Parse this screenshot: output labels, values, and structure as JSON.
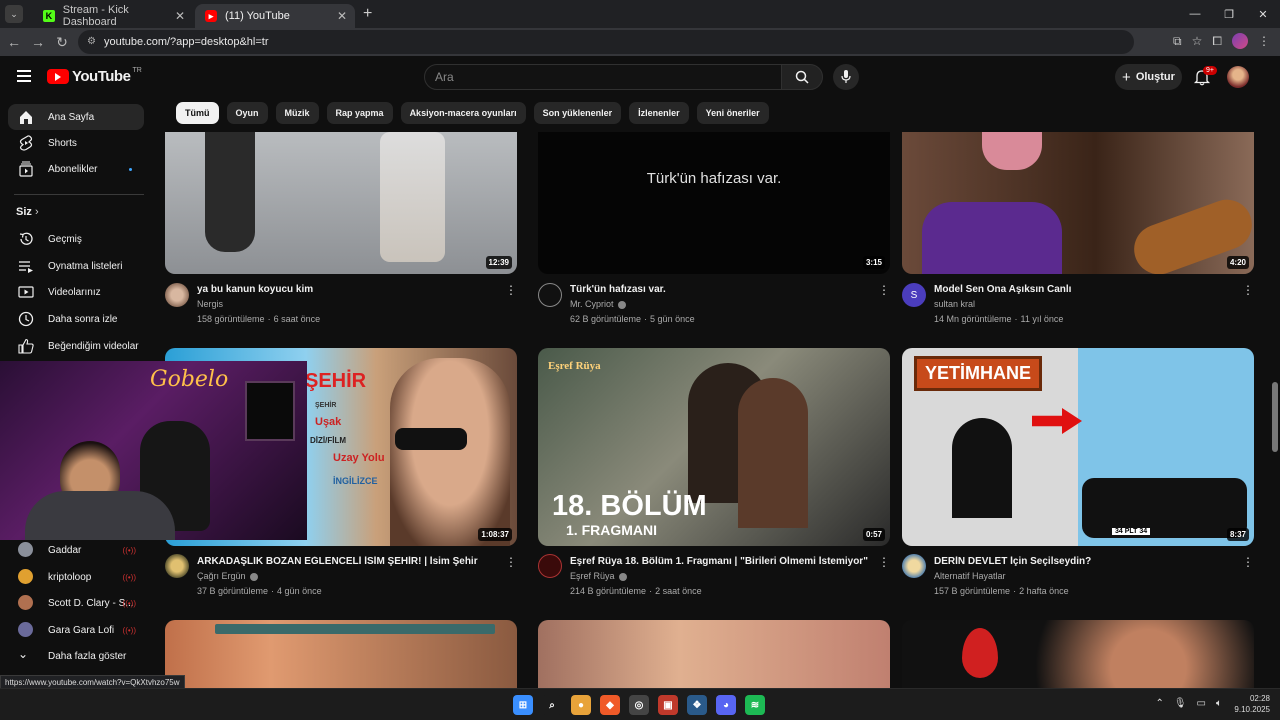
{
  "browser": {
    "tabs": [
      {
        "title": "Stream - Kick Dashboard",
        "favicon": "kick-icon",
        "active": false
      },
      {
        "title": "(11) YouTube",
        "favicon": "youtube-icon",
        "active": true
      }
    ],
    "url": "youtube.com/?app=desktop&hl=tr",
    "status_url": "https://www.youtube.com/watch?v=QkXtvhzo75w"
  },
  "header": {
    "logo_text": "YouTube",
    "logo_region": "TR",
    "search_placeholder": "Ara",
    "create_label": "Oluştur",
    "notifications_badge": "9+"
  },
  "sidebar": {
    "main": [
      {
        "label": "Ana Sayfa",
        "icon": "home-icon",
        "active": true
      },
      {
        "label": "Shorts",
        "icon": "shorts-icon"
      },
      {
        "label": "Abonelikler",
        "icon": "subscriptions-icon",
        "dot": true
      }
    ],
    "you_label": "Siz",
    "you_items": [
      {
        "label": "Geçmiş",
        "icon": "history-icon"
      },
      {
        "label": "Oynatma listeleri",
        "icon": "playlists-icon"
      },
      {
        "label": "Videolarınız",
        "icon": "your-videos-icon"
      },
      {
        "label": "Daha sonra izle",
        "icon": "watch-later-icon"
      },
      {
        "label": "Beğendiğim videolar",
        "icon": "liked-videos-icon"
      }
    ],
    "subscriptions": [
      {
        "label": "Gaddar",
        "color": "#8a8f9a"
      },
      {
        "label": "kriptoloop",
        "color": "#e0a030"
      },
      {
        "label": "Scott D. Clary - S...",
        "color": "#b07050"
      },
      {
        "label": "Gara Gara Lofi",
        "color": "#6a6a9a"
      }
    ],
    "show_more": "Daha fazla göster"
  },
  "chips": [
    "Tümü",
    "Oyun",
    "Müzik",
    "Rap yapma",
    "Aksiyon-macera oyunları",
    "Son yüklenenler",
    "İzlenenler",
    "Yeni öneriler"
  ],
  "videos_row1": [
    {
      "title": "ya bu kanun koyucu kim",
      "channel": "Nergis",
      "views": "158 görüntüleme",
      "age": "6 saat önce",
      "duration": "12:39",
      "verified": false
    },
    {
      "title": "Türk'ün hafızası var.",
      "channel": "Mr. Cypriot",
      "views": "62 B görüntüleme",
      "age": "5 gün önce",
      "duration": "3:15",
      "verified": true,
      "thumb_text": "Türk'ün hafızası var."
    },
    {
      "title": "Model  Sen Ona Aşıksın Canlı",
      "channel": "sultan kral",
      "views": "14 Mn görüntüleme",
      "age": "11 yıl önce",
      "duration": "4:20",
      "verified": false,
      "avatar_letter": "S"
    }
  ],
  "videos_row2": [
    {
      "title": "ARKADAŞLIK BOZAN EĞLENCELİ İSİM ŞEHİR! | İsim Şehir",
      "channel": "Çağrı Ergün",
      "views": "37 B görüntüleme",
      "age": "4 gün önce",
      "duration": "1:08:37",
      "verified": true,
      "thumb_words": [
        "ŞEHİR",
        "Uşak",
        "DİZİ/FİLM",
        "Uzay Yolu",
        "İNGİLİZCE"
      ]
    },
    {
      "title": "Eşref Rüya 18. Bölüm 1. Fragmanı | \"Birileri Ölmemi İstemiyor\"",
      "channel": "Eşref Rüya",
      "views": "214 B görüntüleme",
      "age": "2 saat önce",
      "duration": "0:57",
      "verified": true,
      "thumb_logo": "Eşref Rüya",
      "thumb_big": "18. BÖLÜM",
      "thumb_sub": "1. FRAGMANI"
    },
    {
      "title": "DERİN DEVLET İçin Seçilseydin?",
      "channel": "Alternatif Hayatlar",
      "views": "157 B görüntüleme",
      "age": "2 hafta önce",
      "duration": "8:37",
      "verified": false,
      "thumb_sign": "YETİMHANE",
      "thumb_plate": "34 PLT 34"
    }
  ],
  "webcam": {
    "neon_text": "Gobelo"
  },
  "taskbar": {
    "time": "02:28",
    "date": "9.10.2025",
    "apps": [
      {
        "name": "windows-start-icon",
        "color": "#3a8fff",
        "glyph": "⊞"
      },
      {
        "name": "search-icon",
        "color": "#1c1c1c",
        "glyph": "⌕"
      },
      {
        "name": "chrome-icon",
        "color": "#e8a33a",
        "glyph": "●"
      },
      {
        "name": "brave-icon",
        "color": "#f05a28",
        "glyph": "◆"
      },
      {
        "name": "obs-icon",
        "color": "#444",
        "glyph": "◎"
      },
      {
        "name": "streamer-bot-icon",
        "color": "#c0392b",
        "glyph": "▣"
      },
      {
        "name": "app-icon",
        "color": "#2a5a8a",
        "glyph": "❖"
      },
      {
        "name": "discord-icon",
        "color": "#5865f2",
        "glyph": "◕"
      },
      {
        "name": "spotify-icon",
        "color": "#1db954",
        "glyph": "≋"
      }
    ]
  }
}
